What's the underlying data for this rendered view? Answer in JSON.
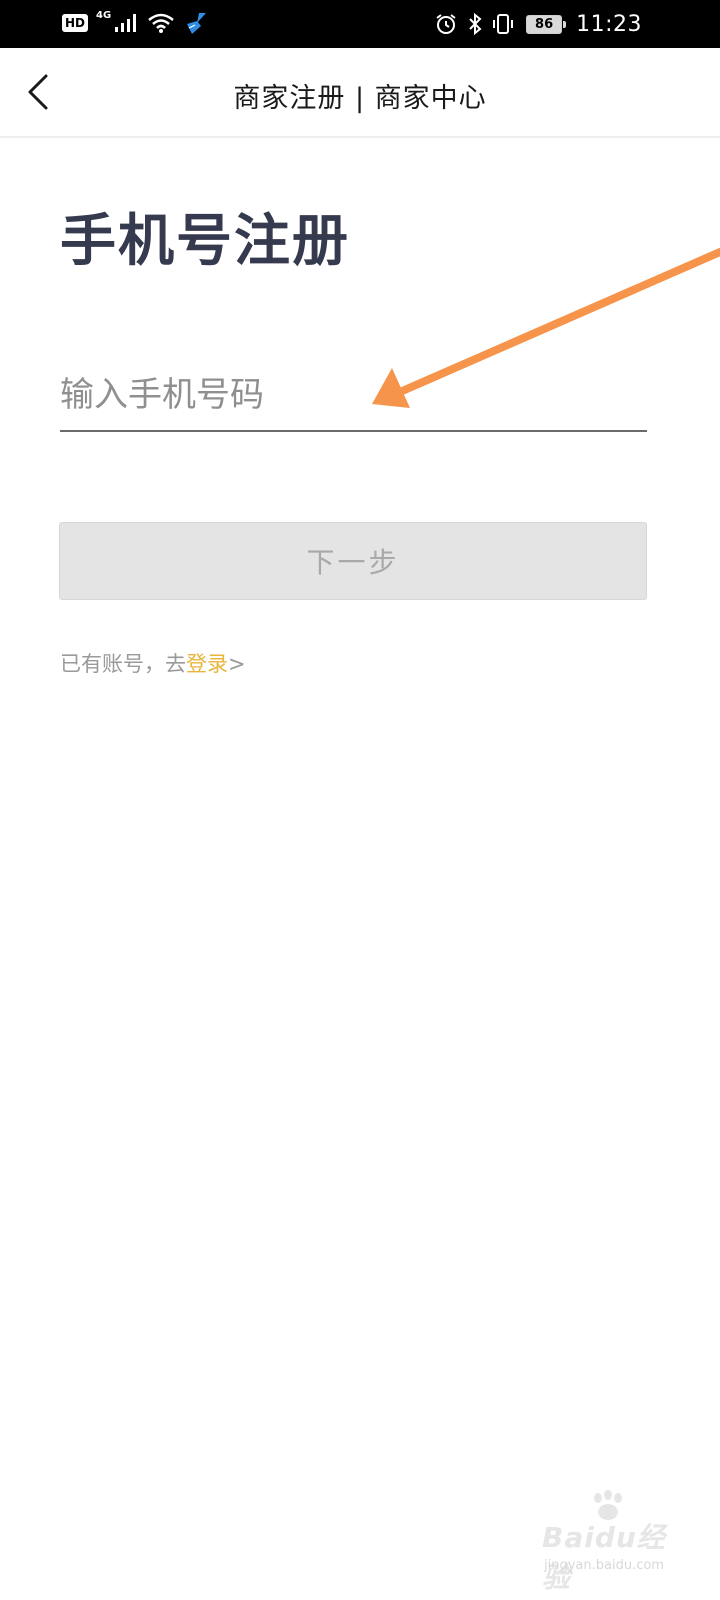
{
  "status_bar": {
    "hd_label": "HD",
    "network_label": "4G",
    "battery_level": "86",
    "time": "11:23",
    "icons": [
      "signal-icon",
      "wifi-icon",
      "cleaner-icon",
      "alarm-icon",
      "bluetooth-icon",
      "vibrate-icon",
      "battery-icon"
    ]
  },
  "navbar": {
    "title": "商家注册 | 商家中心",
    "back_icon": "chevron-left-icon"
  },
  "form": {
    "heading": "手机号注册",
    "phone_placeholder": "输入手机号码",
    "phone_value": "",
    "next_button_label": "下一步",
    "login_prefix": "已有账号，去",
    "login_link_label": "登录",
    "login_suffix": ">"
  },
  "annotation": {
    "arrow_color": "#f5944a"
  },
  "watermark": {
    "brand": "Baidu经验",
    "url": "jingyan.baidu.com"
  },
  "colors": {
    "status_bar_bg": "#000000",
    "heading": "#363a4f",
    "link": "#e8b53a",
    "button_disabled_bg": "#e4e4e4"
  }
}
